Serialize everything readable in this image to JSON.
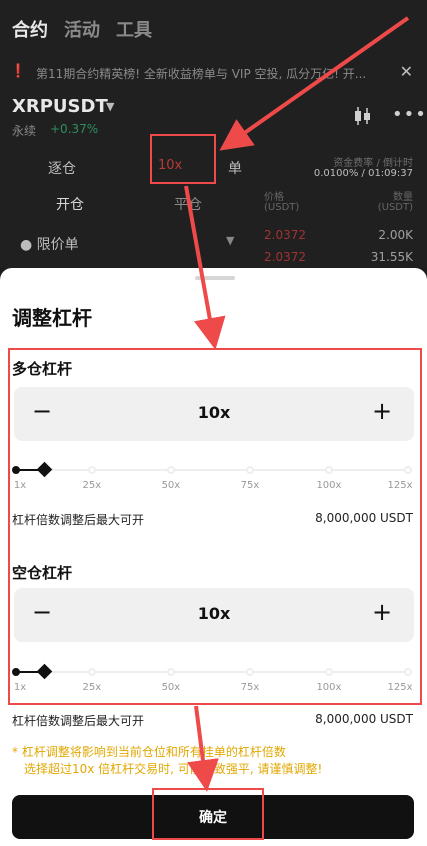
{
  "tabs": [
    "合约",
    "活动",
    "工具"
  ],
  "announcement": {
    "text": "第11期合约精英榜! 全新收益榜单与 VIP 空投, 瓜分万亿! 开..."
  },
  "market": {
    "symbol": "XRPUSDT",
    "sub_label": "永续",
    "change": "+0.37%"
  },
  "trade_panel": {
    "margin_mode": "逐仓",
    "leverage": "10x",
    "unit": "单",
    "funding_label": "资金费率 / 倒计时",
    "funding_value": "0.0100% / 01:09:37",
    "open_tab": "开仓",
    "close_tab": "平仓",
    "price_header": "价格",
    "price_unit": "(USDT)",
    "qty_header": "数量",
    "qty_unit": "(USDT)",
    "order_type": "限价单",
    "asks": [
      {
        "price": "2.0372",
        "qty": "2.00K"
      },
      {
        "price": "2.0372",
        "qty": "31.55K"
      }
    ]
  },
  "dialog": {
    "title": "调整杠杆",
    "long": {
      "label": "多仓杠杆",
      "value": "10x",
      "level": 10,
      "max_open_label": "杠杆倍数调整后最大可开",
      "max_open_value": "8,000,000 USDT"
    },
    "short": {
      "label": "空仓杠杆",
      "value": "10x",
      "level": 10,
      "max_open_label": "杠杆倍数调整后最大可开",
      "max_open_value": "8,000,000 USDT"
    },
    "slider_marks": [
      "1x",
      "25x",
      "50x",
      "75x",
      "100x",
      "125x"
    ],
    "slider_range": [
      1,
      125
    ],
    "warning_line1": "* 杠杆调整将影响到当前仓位和所有挂单的杠杆倍数",
    "warning_line2": "选择超过10x 倍杠杆交易时, 可能导致强平, 请谨慎调整!",
    "confirm_label": "确定"
  },
  "colors": {
    "highlight": "#ef4a4a",
    "warning": "#e2a700",
    "primary": "#111111",
    "positive": "#2e8f5e"
  }
}
